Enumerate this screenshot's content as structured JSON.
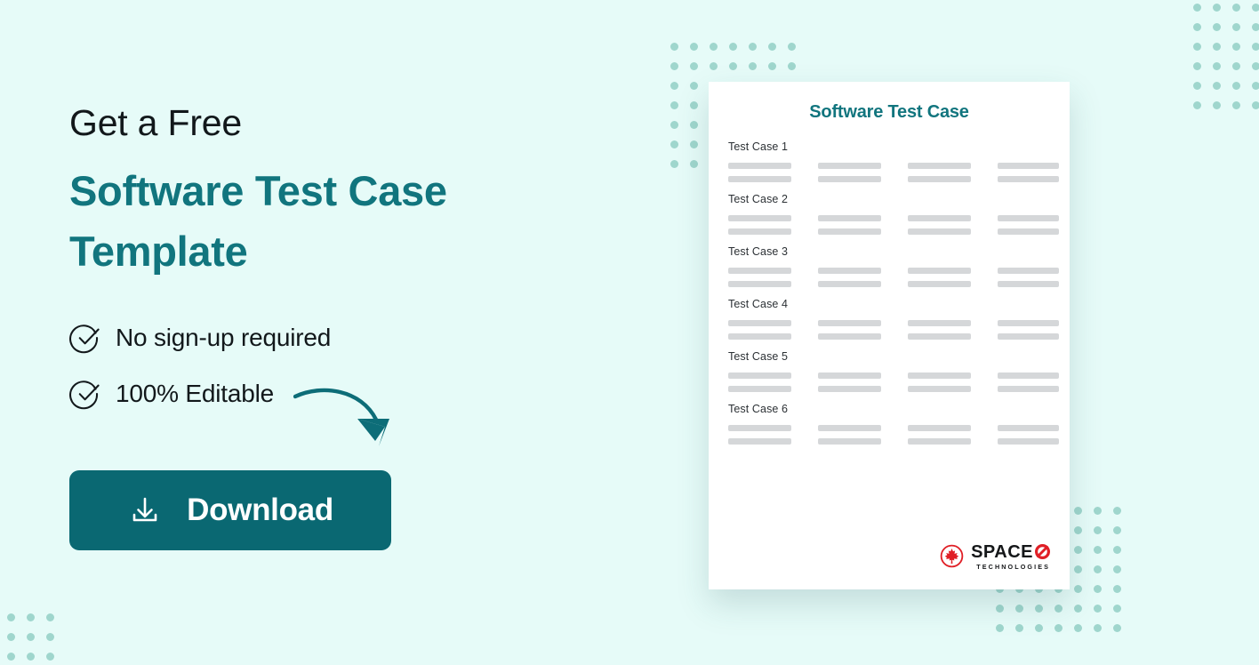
{
  "theme": {
    "background": "#e6fbf8",
    "teal": "#11757e",
    "button_teal": "#0a6872",
    "dot_color": "#9fd6cd",
    "bar_gray": "#d5d7d9",
    "logo_red": "#e01f26",
    "text_dark": "#12181b"
  },
  "hero": {
    "headline_line1": "Get a Free",
    "headline_line2": "Software Test Case Template",
    "features": [
      {
        "label": "No sign-up required",
        "icon": "check-circle-icon"
      },
      {
        "label": "100% Editable",
        "icon": "check-circle-icon"
      }
    ],
    "cta": {
      "label": "Download",
      "icon": "download-icon"
    },
    "arrow_icon": "curved-arrow-icon"
  },
  "document": {
    "title": "Software Test Case",
    "cases": [
      {
        "label": "Test Case 1"
      },
      {
        "label": "Test Case 2"
      },
      {
        "label": "Test Case 3"
      },
      {
        "label": "Test Case 4"
      },
      {
        "label": "Test Case 5"
      },
      {
        "label": "Test Case 6"
      }
    ],
    "rows_per_case": 2,
    "columns_per_row": 4,
    "logo": {
      "mark_icon": "maple-leaf-circle-icon",
      "name": "SPACE",
      "o_icon": "slashed-o-icon",
      "tagline": "TECHNOLOGIES"
    }
  },
  "decor": {
    "dot_grids": [
      {
        "name": "dots-top-right",
        "cols": 4,
        "rows": 6,
        "spacing": 22,
        "size": 9
      },
      {
        "name": "dots-bottom-left",
        "cols": 3,
        "rows": 3,
        "spacing": 22,
        "size": 9
      },
      {
        "name": "dots-card-topleft",
        "cols": 7,
        "rows": 7,
        "spacing": 22,
        "size": 9
      },
      {
        "name": "dots-card-bottom",
        "cols": 7,
        "rows": 7,
        "spacing": 22,
        "size": 9
      }
    ]
  }
}
